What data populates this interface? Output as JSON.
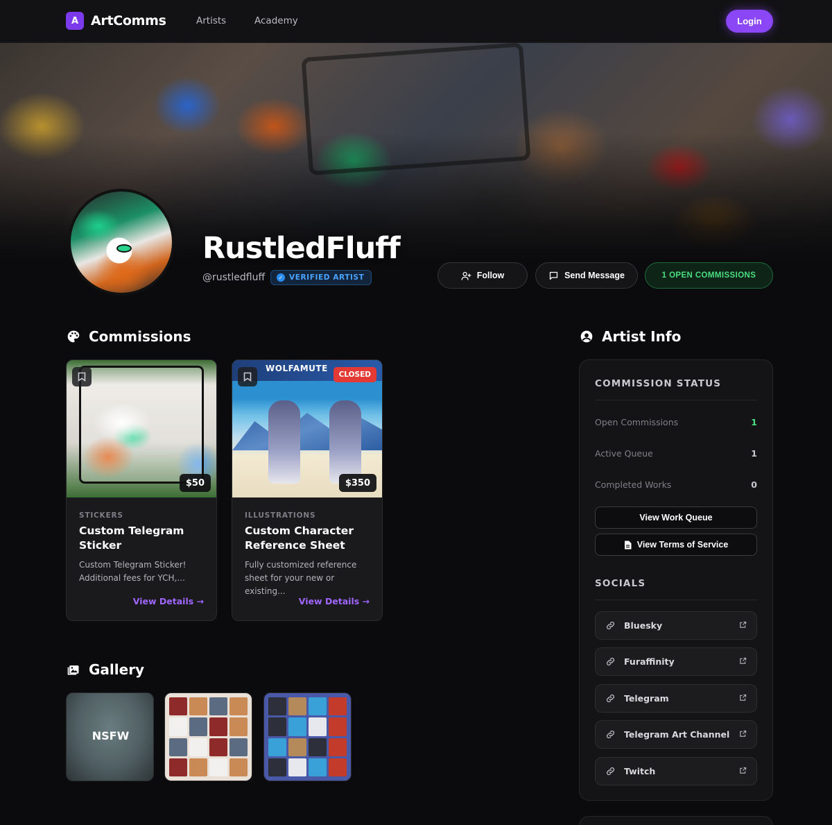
{
  "header": {
    "brand": "ArtComms",
    "brand_initial": "A",
    "nav": [
      "Artists",
      "Academy"
    ],
    "login_label": "Login",
    "accent_color": "#8b46f5"
  },
  "profile": {
    "name": "RustledFluff",
    "handle": "@rustledfluff",
    "verified_label": "VERIFIED ARTIST",
    "follow_label": "Follow",
    "message_label": "Send Message",
    "open_commissions_label": "1 OPEN COMMISSIONS"
  },
  "commissions": {
    "title": "Commissions",
    "cards": [
      {
        "category": "STICKERS",
        "title": "Custom Telegram Sticker",
        "description": "Custom Telegram Sticker! Additional fees for YCH,...",
        "price": "$50",
        "link": "View Details →",
        "status": ""
      },
      {
        "category": "ILLUSTRATIONS",
        "title": "Custom Character Reference Sheet",
        "description": "Fully customized reference sheet for your new or existing...",
        "price": "$350",
        "link": "View Details →",
        "status": "CLOSED",
        "image_text": "WOLFAMUTE"
      }
    ]
  },
  "gallery": {
    "title": "Gallery",
    "items": [
      {
        "label": "NSFW"
      },
      {
        "label": ""
      },
      {
        "label": ""
      }
    ]
  },
  "artist_info": {
    "title": "Artist Info",
    "status_heading": "COMMISSION STATUS",
    "stats": [
      {
        "label": "Open Commissions",
        "value": "1",
        "color": "#4ade80"
      },
      {
        "label": "Active Queue",
        "value": "1"
      },
      {
        "label": "Completed Works",
        "value": "0"
      }
    ],
    "queue_button": "View Work Queue",
    "tos_button": "View Terms of Service",
    "socials_heading": "SOCIALS",
    "socials": [
      "Bluesky",
      "Furaffinity",
      "Telegram",
      "Telegram Art Channel",
      "Twitch"
    ]
  },
  "icons": {
    "follow": "user-plus-icon",
    "message": "message-square-icon",
    "commissions": "palette-icon",
    "artist_info": "user-circle-icon",
    "gallery": "images-icon",
    "tos": "file-icon",
    "social_link": "link-icon",
    "external": "external-link-icon",
    "bookmark": "bookmark-icon",
    "verified": "check-badge-icon"
  }
}
